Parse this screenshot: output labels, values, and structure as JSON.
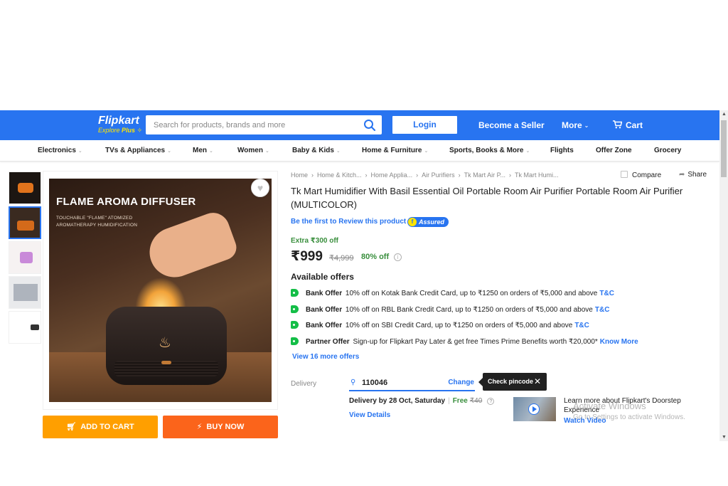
{
  "header": {
    "logo": "Flipkart",
    "logo_sub": "Explore",
    "logo_plus": "Plus",
    "search_placeholder": "Search for products, brands and more",
    "login": "Login",
    "seller": "Become a Seller",
    "more": "More",
    "cart": "Cart"
  },
  "categories": [
    "Electronics",
    "TVs & Appliances",
    "Men",
    "Women",
    "Baby & Kids",
    "Home & Furniture",
    "Sports, Books & More",
    "Flights",
    "Offer Zone",
    "Grocery"
  ],
  "image": {
    "title": "FLAME AROMA DIFFUSER",
    "subtitle_1": "TOUCHABLE \"FLAME\" ATOMIZED",
    "subtitle_2": "AROMATHERAPY HUMIDIFICATION"
  },
  "buttons": {
    "add_to_cart": "ADD TO CART",
    "buy_now": "BUY NOW"
  },
  "breadcrumbs": [
    "Home",
    "Home & Kitch...",
    "Home Applia...",
    "Air Purifiers",
    "Tk Mart Air P...",
    "Tk Mart Humi..."
  ],
  "compare": "Compare",
  "share": "Share",
  "product": {
    "title": "Tk Mart Humidifier With Basil Essential Oil Portable Room Air Purifier Portable Room Air Purifier  (MULTICOLOR)",
    "review_link": "Be the first to Review this product",
    "assured": "Assured",
    "extra": "Extra ₹300 off",
    "price": "₹999",
    "mrp": "₹4,999",
    "discount": "80% off"
  },
  "offers": {
    "heading": "Available offers",
    "items": [
      {
        "kind": "Bank Offer",
        "text": "10% off on Kotak Bank Credit Card, up to ₹1250 on orders of ₹5,000 and above",
        "link": "T&C"
      },
      {
        "kind": "Bank Offer",
        "text": "10% off on RBL Bank Credit Card, up to ₹1250 on orders of ₹5,000 and above",
        "link": "T&C"
      },
      {
        "kind": "Bank Offer",
        "text": "10% off on SBI Credit Card, up to ₹1250 on orders of ₹5,000 and above",
        "link": "T&C"
      },
      {
        "kind": "Partner Offer",
        "text": "Sign-up for Flipkart Pay Later & get free Times Prime Benefits worth ₹20,000*",
        "link": "Know More"
      }
    ],
    "view_more": "View 16 more offers"
  },
  "delivery": {
    "label": "Delivery",
    "pincode": "110046",
    "change": "Change",
    "tooltip": "Check pincode",
    "date_text": "Delivery by 28 Oct, Saturday",
    "free": "Free",
    "fee": "₹40",
    "view_details": "View Details",
    "learn_more": "Learn more about Flipkart's Doorstep Experience",
    "watch_video": "Watch Video"
  },
  "watermark": {
    "line1": "Activate Windows",
    "line2": "Go to Settings to activate Windows."
  },
  "colors": {
    "brand_blue": "#2874f0",
    "cart_orange": "#ff9f00",
    "buy_orange": "#fb641b",
    "offer_green": "#388e3c"
  }
}
